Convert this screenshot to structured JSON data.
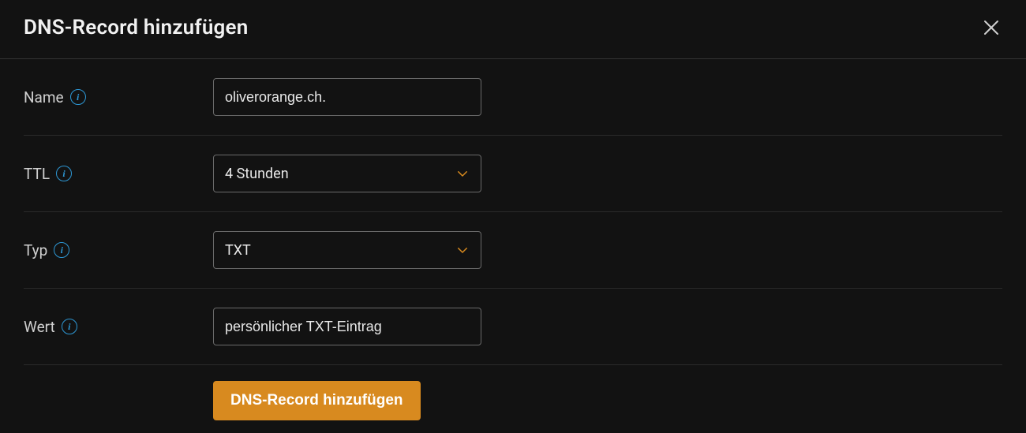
{
  "dialog": {
    "title": "DNS-Record hinzufügen"
  },
  "fields": {
    "name": {
      "label": "Name",
      "value": "oliverorange.ch."
    },
    "ttl": {
      "label": "TTL",
      "selected": "4 Stunden"
    },
    "type": {
      "label": "Typ",
      "selected": "TXT"
    },
    "value": {
      "label": "Wert",
      "value": "persönlicher TXT-Eintrag"
    }
  },
  "actions": {
    "submit": "DNS-Record hinzufügen"
  }
}
